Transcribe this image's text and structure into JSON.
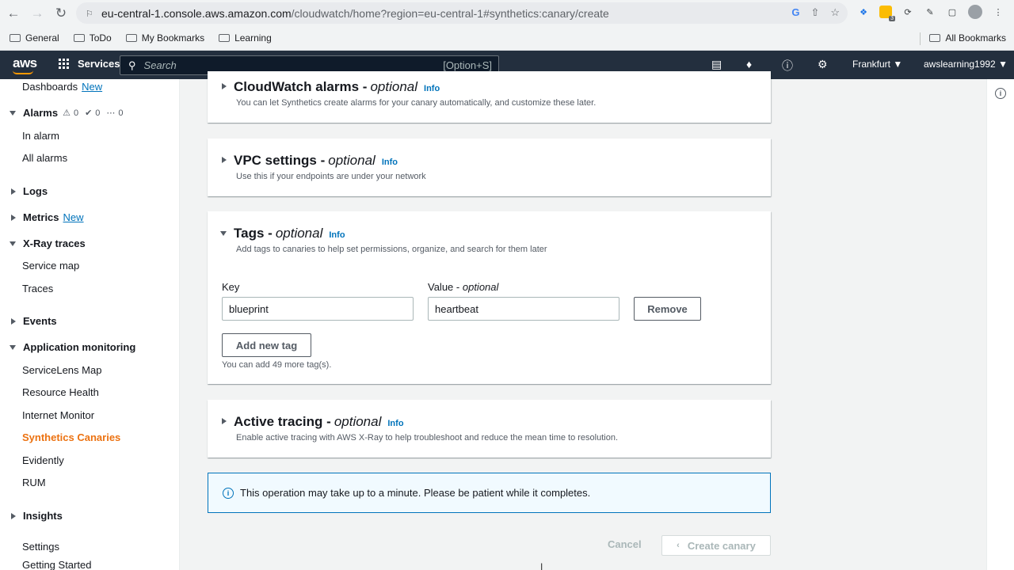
{
  "browser": {
    "url_host": "eu-central-1.console.aws.amazon.com",
    "url_rest": "/cloudwatch/home?region=eu-central-1#synthetics:canary/create",
    "ext_badge": "3",
    "bookmarks": [
      "General",
      "ToDo",
      "My Bookmarks",
      "Learning"
    ],
    "all_bookmarks": "All Bookmarks"
  },
  "awsnav": {
    "logo": "aws",
    "services": "Services",
    "search_placeholder": "Search",
    "search_shortcut": "[Option+S]",
    "region": "Frankfurt",
    "user": "awslearning1992"
  },
  "sidebar": {
    "dashboards": "Dashboards",
    "new": "New",
    "alarms": "Alarms",
    "alarm_counts": [
      "0",
      "0",
      "0"
    ],
    "in_alarm": "In alarm",
    "all_alarms": "All alarms",
    "logs": "Logs",
    "metrics": "Metrics",
    "xray": "X-Ray traces",
    "service_map": "Service map",
    "traces": "Traces",
    "events": "Events",
    "app_monitoring": "Application monitoring",
    "servicelens": "ServiceLens Map",
    "resource_health": "Resource Health",
    "internet_monitor": "Internet Monitor",
    "synthetics": "Synthetics Canaries",
    "evidently": "Evidently",
    "rum": "RUM",
    "insights": "Insights",
    "settings": "Settings",
    "getting_started": "Getting Started"
  },
  "panels": {
    "alarms": {
      "title": "CloudWatch alarms -",
      "optional": "optional",
      "info": "Info",
      "desc": "You can let Synthetics create alarms for your canary automatically, and customize these later."
    },
    "vpc": {
      "title": "VPC settings -",
      "optional": "optional",
      "info": "Info",
      "desc": "Use this if your endpoints are under your network"
    },
    "tags": {
      "title": "Tags -",
      "optional": "optional",
      "info": "Info",
      "desc": "Add tags to canaries to help set permissions, organize, and search for them later",
      "key_label": "Key",
      "value_label": "Value -",
      "value_optional": "optional",
      "key_value": "blueprint",
      "value_value": "heartbeat",
      "remove": "Remove",
      "add_tag": "Add new tag",
      "hint": "You can add 49 more tag(s)."
    },
    "tracing": {
      "title": "Active tracing -",
      "optional": "optional",
      "info": "Info",
      "desc": "Enable active tracing with AWS X-Ray to help troubleshoot and reduce the mean time to resolution."
    }
  },
  "alert": {
    "text": "This operation may take up to a minute. Please be patient while it completes."
  },
  "footer": {
    "cancel": "Cancel",
    "create": "Create canary"
  },
  "colors": {
    "nav_bg": "#232f3e",
    "accent": "#ec7211",
    "link": "#0073bb"
  }
}
